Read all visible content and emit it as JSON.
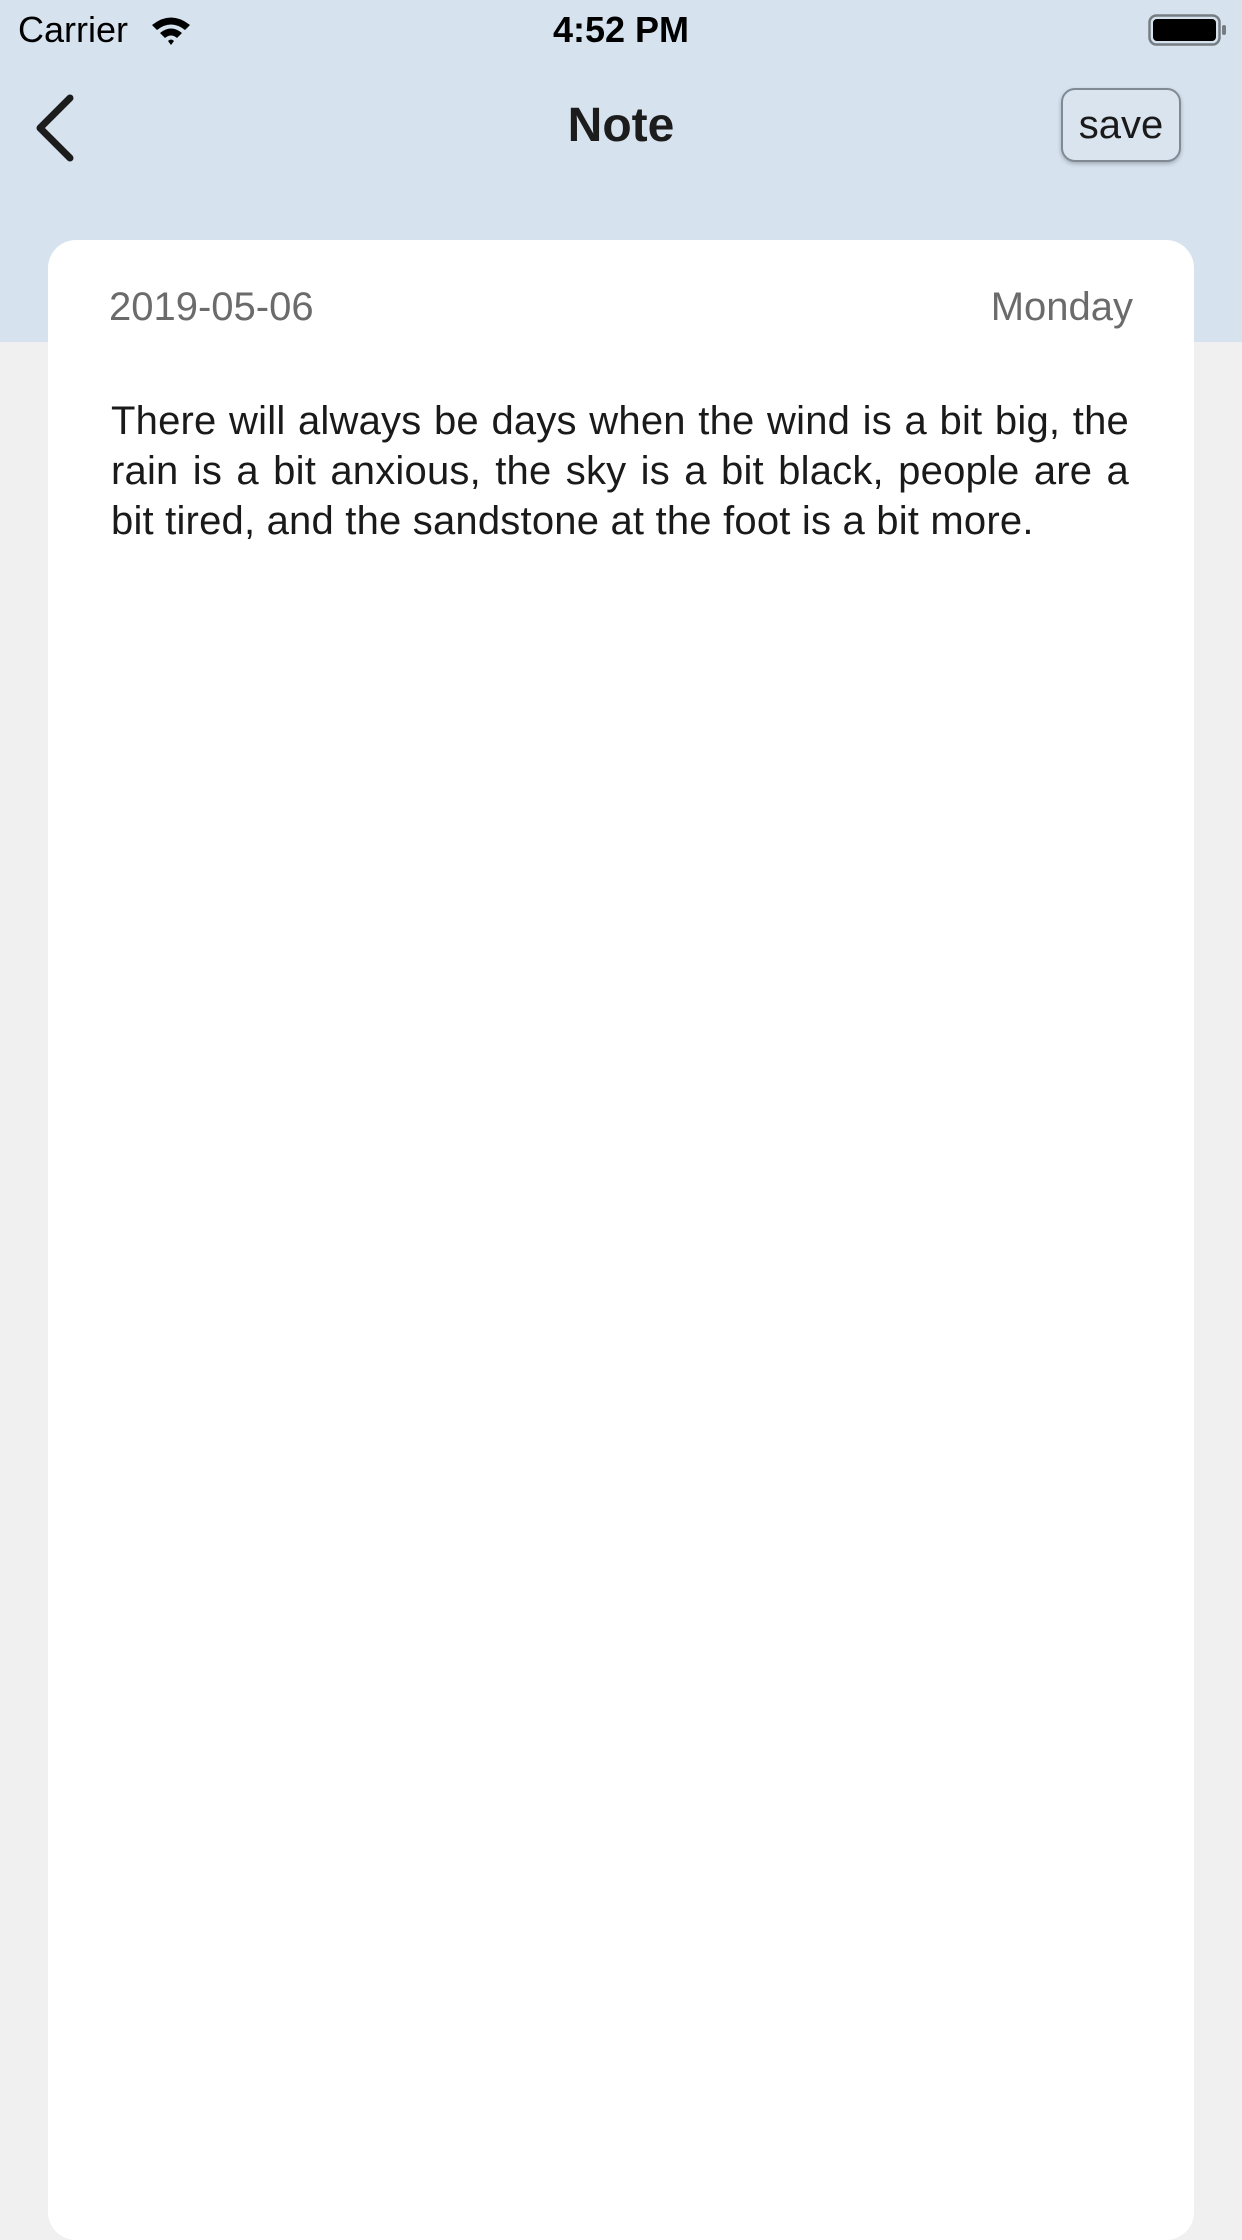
{
  "status_bar": {
    "carrier": "Carrier",
    "time": "4:52 PM",
    "wifi_icon": "wifi-icon",
    "battery_icon": "battery-full-icon"
  },
  "nav": {
    "back_icon": "chevron-left-icon",
    "title": "Note",
    "save_label": "save"
  },
  "note": {
    "date": "2019-05-06",
    "weekday": "Monday",
    "body": "There will always be days when the wind is a bit big, the rain is a bit anxious, the sky is a bit black, people are a bit tired, and the sandstone at the foot is a bit more."
  },
  "colors": {
    "header_background": "#d6e3ef",
    "page_background": "#f0f0f0",
    "card_background": "#ffffff",
    "secondary_text": "#6b6b6b"
  }
}
